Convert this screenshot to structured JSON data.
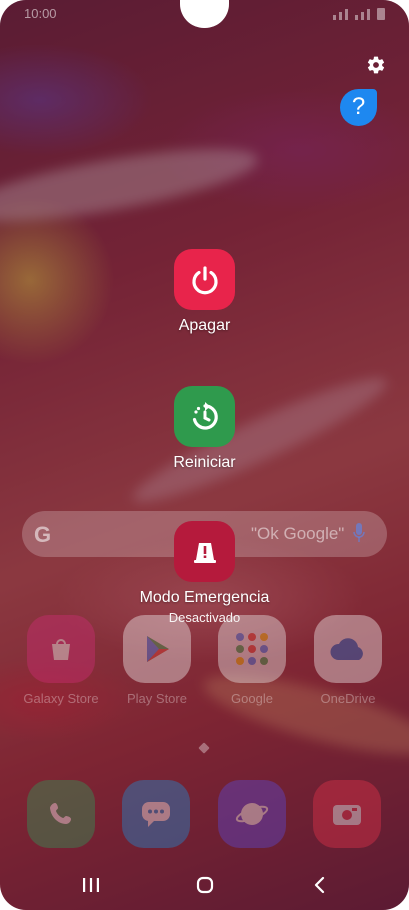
{
  "status": {
    "time": "10:00"
  },
  "icons": {
    "help_glyph": "?",
    "settings": "gear-icon",
    "help": "question-icon",
    "power_off": "power-icon",
    "restart": "restart-icon",
    "emergency": "emergency-light-icon"
  },
  "colors": {
    "power_off": "#e8244b",
    "restart": "#2f9a4d",
    "emergency": "#b51a3c",
    "help": "#1e88f0"
  },
  "power_menu": {
    "power_off": "Apagar",
    "restart": "Reiniciar",
    "emergency_mode": "Modo Emergencia",
    "emergency_status": "Desactivado"
  },
  "search": {
    "logo": "G",
    "hint": "\"Ok Google\""
  },
  "apps": [
    {
      "label": "Galaxy Store"
    },
    {
      "label": "Play Store"
    },
    {
      "label": "Google"
    },
    {
      "label": "OneDrive"
    }
  ],
  "dock": [
    "Phone",
    "Messages",
    "Internet",
    "Camera"
  ]
}
